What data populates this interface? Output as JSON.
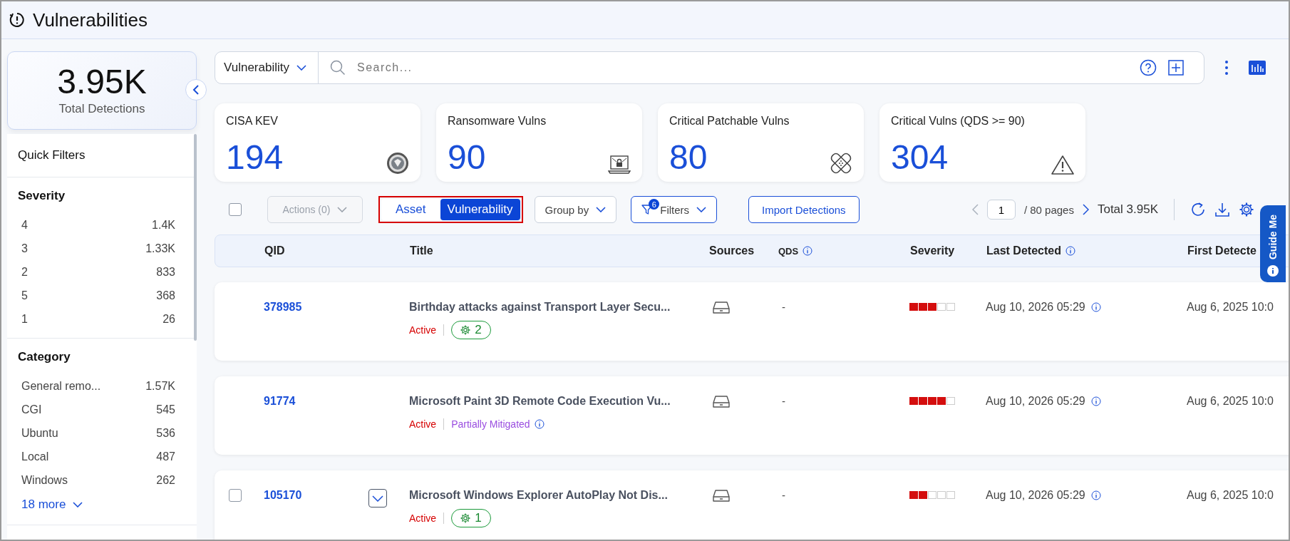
{
  "header": {
    "title": "Vulnerabilities"
  },
  "sidebar": {
    "total": {
      "value": "3.95K",
      "label": "Total Detections"
    },
    "quick_filters_title": "Quick Filters",
    "sections": [
      {
        "title": "Severity",
        "items": [
          {
            "label": "4",
            "count": "1.4K"
          },
          {
            "label": "3",
            "count": "1.33K"
          },
          {
            "label": "2",
            "count": "833"
          },
          {
            "label": "5",
            "count": "368"
          },
          {
            "label": "1",
            "count": "26"
          }
        ]
      },
      {
        "title": "Category",
        "items": [
          {
            "label": "General remo...",
            "count": "1.57K"
          },
          {
            "label": "CGI",
            "count": "545"
          },
          {
            "label": "Ubuntu",
            "count": "536"
          },
          {
            "label": "Local",
            "count": "487"
          },
          {
            "label": "Windows",
            "count": "262"
          }
        ],
        "more": "18 more"
      }
    ]
  },
  "search": {
    "scope": "Vulnerability",
    "placeholder": "Search..."
  },
  "kpis": [
    {
      "title": "CISA KEV",
      "value": "194",
      "kind": "seal"
    },
    {
      "title": "Ransomware Vulns",
      "value": "90",
      "kind": "laptop-lock"
    },
    {
      "title": "Critical Patchable Vulns",
      "value": "80",
      "kind": "bandage"
    },
    {
      "title": "Critical Vulns (QDS >= 90)",
      "value": "304",
      "kind": "warning"
    }
  ],
  "toolbar": {
    "select_all_checked": false,
    "actions": "Actions (0)",
    "actions_disabled": true,
    "view_toggle": [
      {
        "label": "Asset",
        "selected": false
      },
      {
        "label": "Vulnerability",
        "selected": true
      }
    ],
    "group_by": "Group by",
    "filters": {
      "label": "Filters",
      "badge": "6"
    },
    "import": "Import Detections",
    "page": "1",
    "pages": "/ 80 pages",
    "total": "Total 3.95K"
  },
  "table": {
    "columns": [
      {
        "label": "QID"
      },
      {
        "label": "Title"
      },
      {
        "label": "Sources"
      },
      {
        "label": "QDS",
        "info": true
      },
      {
        "label": "Severity"
      },
      {
        "label": "Last Detected",
        "info": true
      },
      {
        "label": "First Detecte"
      }
    ],
    "rows": [
      {
        "qid": "378985",
        "title": "Birthday attacks against Transport Layer Secu...",
        "status": "Active",
        "tag": {
          "kind": "gear-count",
          "text": "2"
        },
        "qds": "-",
        "level": 0.6,
        "last_detected": "Aug 10, 2026 05:29",
        "first_detected": "Aug 6, 2025 10:0",
        "hovered": false,
        "checked": false
      },
      {
        "qid": "91774",
        "title": "Microsoft Paint 3D Remote Code Execution Vu...",
        "status": "Active",
        "tag": {
          "kind": "mitigation",
          "text": "Partially Mitigated"
        },
        "qds": "-",
        "level": 0.8,
        "last_detected": "Aug 10, 2026 05:29",
        "first_detected": "Aug 6, 2025 10:0",
        "hovered": false,
        "checked": false
      },
      {
        "qid": "105170",
        "title": "Microsoft Windows Explorer AutoPlay Not Dis...",
        "status": "Active",
        "tag": {
          "kind": "gear-count",
          "text": "1"
        },
        "qds": "-",
        "level": 0.4,
        "last_detected": "Aug 10, 2026 05:29",
        "first_detected": "Aug 6, 2025 10:0",
        "hovered": true,
        "checked": false
      }
    ]
  },
  "guide": {
    "label": "Guide Me"
  }
}
